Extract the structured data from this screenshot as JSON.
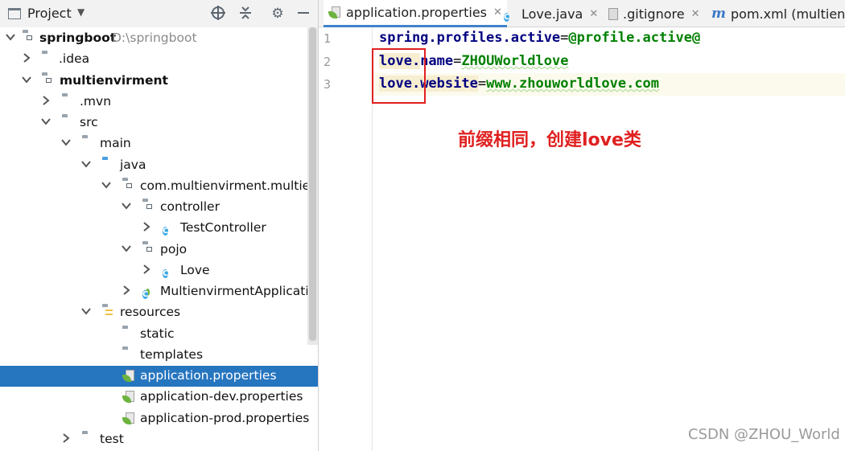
{
  "project_panel": {
    "title": "Project",
    "tree": [
      {
        "label": "springboot",
        "path": "D:\\springboot",
        "icon": "module-folder-icon",
        "bold": true,
        "expanded": true
      },
      {
        "label": ".idea",
        "icon": "folder-icon",
        "expanded": false
      },
      {
        "label": "multienvirment",
        "icon": "module-folder-icon",
        "bold": true,
        "expanded": true
      },
      {
        "label": ".mvn",
        "icon": "folder-icon",
        "expanded": false
      },
      {
        "label": "src",
        "icon": "folder-icon",
        "expanded": true
      },
      {
        "label": "main",
        "icon": "folder-icon",
        "expanded": true
      },
      {
        "label": "java",
        "icon": "source-folder-icon",
        "expanded": true
      },
      {
        "label": "com.multienvirment.multienvir",
        "icon": "package-icon",
        "expanded": true
      },
      {
        "label": "controller",
        "icon": "package-icon",
        "expanded": true
      },
      {
        "label": "TestController",
        "icon": "class-icon",
        "expanded": false
      },
      {
        "label": "pojo",
        "icon": "package-icon",
        "expanded": true
      },
      {
        "label": "Love",
        "icon": "class-icon",
        "expanded": false
      },
      {
        "label": "MultienvirmentApplication",
        "icon": "spring-boot-class-icon",
        "expanded": false
      },
      {
        "label": "resources",
        "icon": "resources-folder-icon",
        "expanded": true
      },
      {
        "label": "static",
        "icon": "folder-icon"
      },
      {
        "label": "templates",
        "icon": "folder-icon"
      },
      {
        "label": "application.properties",
        "icon": "spring-properties-icon",
        "selected": true
      },
      {
        "label": "application-dev.properties",
        "icon": "spring-properties-icon"
      },
      {
        "label": "application-prod.properties",
        "icon": "spring-properties-icon"
      },
      {
        "label": "test",
        "icon": "folder-icon",
        "expanded": false
      }
    ]
  },
  "tabs": [
    {
      "label": "application.properties",
      "icon": "spring-properties-icon",
      "active": true
    },
    {
      "label": "Love.java",
      "icon": "class-icon"
    },
    {
      "label": ".gitignore",
      "icon": "file-icon"
    },
    {
      "label": "pom.xml (multienvi",
      "icon": "maven-icon"
    }
  ],
  "editor": {
    "lines": [
      {
        "number": "1",
        "key": "spring.profiles.active",
        "eq": "=",
        "value": "@profile.active@"
      },
      {
        "number": "2",
        "key_prefix": "love.",
        "key_rest": "name",
        "eq": "=",
        "value": "ZHOUWorldlove"
      },
      {
        "number": "3",
        "key_prefix": "love.",
        "key_rest": "website",
        "eq": "=",
        "value": "www.zhouworldlove.com"
      }
    ],
    "annotation": "前缀相同，创建love类"
  },
  "watermark": "CSDN @ZHOU_World",
  "colors": {
    "accent": "#2675bf",
    "annotation": "#e02020",
    "key": "#000080",
    "value": "#008000"
  }
}
